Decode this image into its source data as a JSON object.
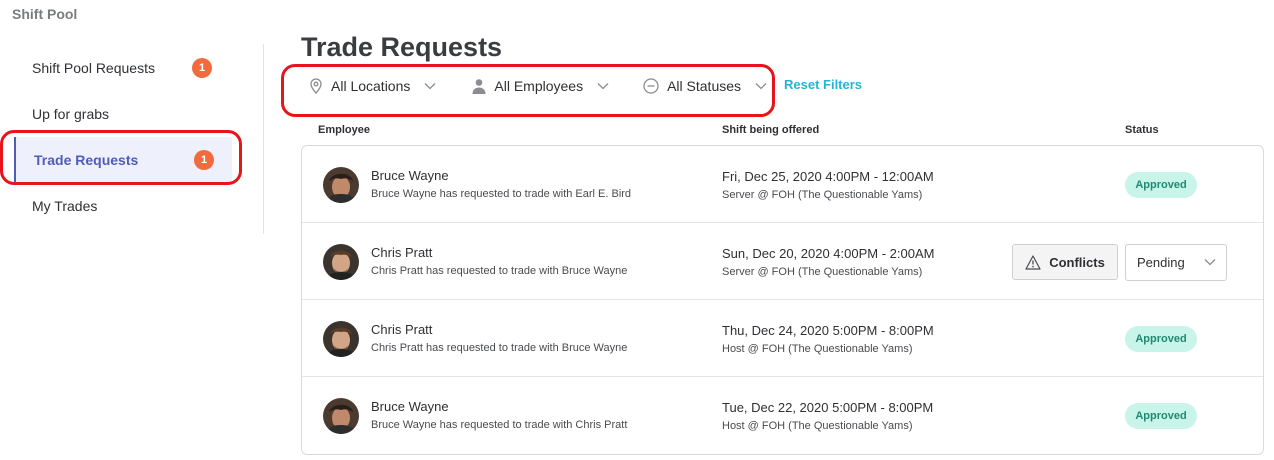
{
  "app": {
    "title": "Shift Pool"
  },
  "sidebar": {
    "items": [
      {
        "label": "Shift Pool Requests",
        "count": "1"
      },
      {
        "label": "Up for grabs"
      },
      {
        "label": "Trade Requests",
        "count": "1",
        "active": true
      },
      {
        "label": "My Trades"
      }
    ]
  },
  "page": {
    "title": "Trade Requests"
  },
  "filters": {
    "location": {
      "label": "All Locations",
      "icon": "location-pin-icon"
    },
    "employee": {
      "label": "All Employees",
      "icon": "person-icon"
    },
    "status": {
      "label": "All Statuses",
      "icon": "minus-circle-icon"
    },
    "reset_label": "Reset Filters"
  },
  "table": {
    "headers": {
      "employee": "Employee",
      "shift": "Shift being offered",
      "status": "Status"
    },
    "rows": [
      {
        "name": "Bruce Wayne",
        "description": "Bruce Wayne has requested to trade with Earl E. Bird",
        "shift_time": "Fri, Dec 25, 2020 4:00PM - 12:00AM",
        "shift_position": "Server @ FOH (The Questionable Yams)",
        "status": "Approved"
      },
      {
        "name": "Chris Pratt",
        "description": "Chris Pratt has requested to trade with Bruce Wayne",
        "shift_time": "Sun, Dec 20, 2020 4:00PM - 2:00AM",
        "shift_position": "Server @ FOH (The Questionable Yams)",
        "conflicts_label": "Conflicts",
        "status": "Pending"
      },
      {
        "name": "Chris Pratt",
        "description": "Chris Pratt has requested to trade with Bruce Wayne",
        "shift_time": "Thu, Dec 24, 2020 5:00PM - 8:00PM",
        "shift_position": "Host @ FOH (The Questionable Yams)",
        "status": "Approved"
      },
      {
        "name": "Bruce Wayne",
        "description": "Bruce Wayne has requested to trade with Chris Pratt",
        "shift_time": "Tue, Dec 22, 2020 5:00PM - 8:00PM",
        "shift_position": "Host @ FOH (The Questionable Yams)",
        "status": "Approved"
      }
    ]
  },
  "colors": {
    "accent": "#4f5cb8",
    "badge": "#f16b3f",
    "link": "#25b4d6",
    "approved_bg": "#c8f4ea",
    "approved_text": "#1f8a72",
    "highlight": "#e8141c"
  }
}
